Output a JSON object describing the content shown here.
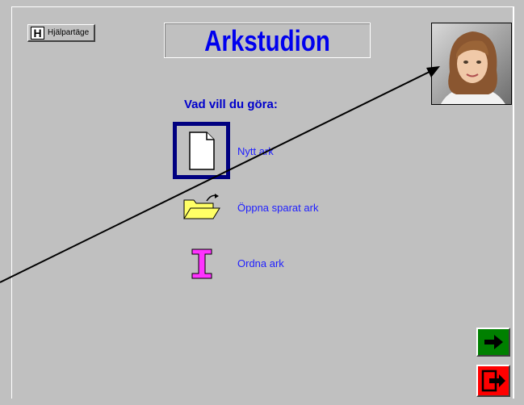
{
  "help_button": {
    "label": "Hjälpartäge",
    "icon": "H"
  },
  "title": "Arkstudion",
  "question": "Vad vill du göra:",
  "menu": [
    {
      "label": "Nytt ark",
      "icon": "new-document-icon"
    },
    {
      "label": "Öppna sparat ark",
      "icon": "open-folder-icon"
    },
    {
      "label": "Ordna ark",
      "icon": "text-cursor-icon"
    }
  ],
  "nav": {
    "next_icon": "right-arrow-icon",
    "exit_icon": "exit-door-icon"
  },
  "colors": {
    "background": "#c0c0c0",
    "title": "#0000ee",
    "label": "#2020ff",
    "next_button": "#008000",
    "exit_button": "#ff0000",
    "selection_frame": "#000080",
    "folder": "#ffff66",
    "cursor_icon": "#ff00ff"
  }
}
